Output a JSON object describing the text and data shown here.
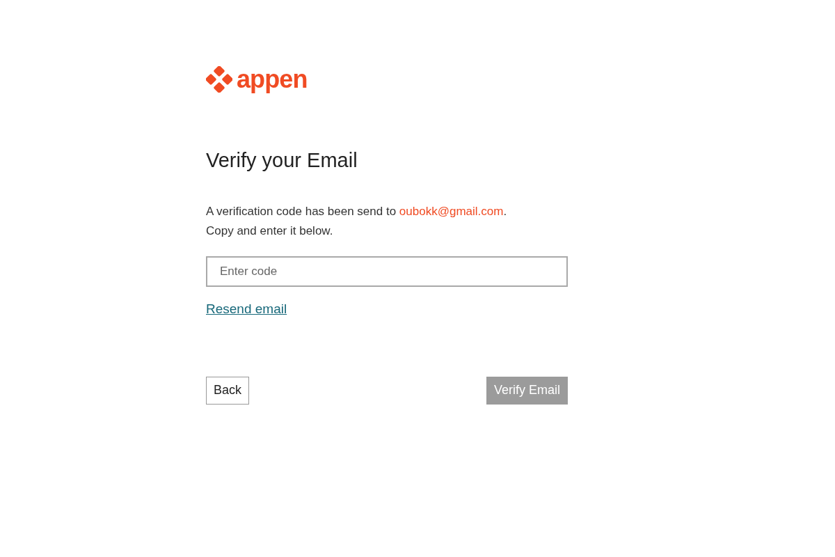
{
  "logo": {
    "text": "appen"
  },
  "heading": "Verify your Email",
  "message": {
    "before": "A verification code has been send to ",
    "email": "oubokk@gmail.com",
    "after": ".",
    "line2": "Copy and enter it below."
  },
  "code_field": {
    "placeholder": "Enter code"
  },
  "resend_link": "Resend email",
  "buttons": [
    {
      "label": "Back",
      "kind": "secondary",
      "disabled": false
    },
    {
      "label": "Verify Email",
      "kind": "primary",
      "disabled": true
    }
  ]
}
